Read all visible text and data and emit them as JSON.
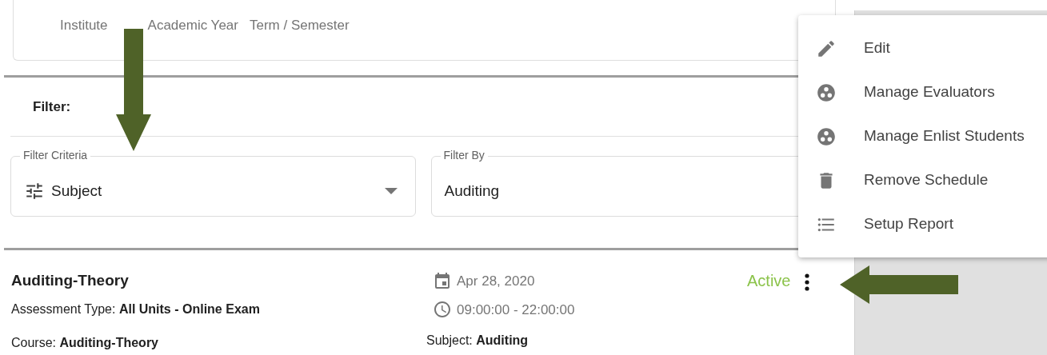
{
  "header_labels": [
    "Institute",
    "Academic Year",
    "Term / Semester"
  ],
  "filter": {
    "title": "Filter:",
    "fields": [
      {
        "kind": "select",
        "label": "Filter Criteria",
        "value": "Subject"
      },
      {
        "kind": "text",
        "label": "Filter By",
        "value": "Auditing"
      }
    ]
  },
  "schedule": {
    "title": "Auditing-Theory",
    "assessment": "Assessment Type: **All Units - Online Exam**",
    "course": "Course: **Auditing-Theory**",
    "date": "Apr 28, 2020",
    "time": "09:00:00 - 22:00:00",
    "subject": "Subject: **Auditing**",
    "status": "Active"
  },
  "menu": [
    {
      "kind": "edit",
      "label": "Edit"
    },
    {
      "kind": "group",
      "label": "Manage Evaluators"
    },
    {
      "kind": "group",
      "label": "Manage Enlist Students"
    },
    {
      "kind": "delete",
      "label": "Remove Schedule"
    },
    {
      "kind": "list",
      "label": "Setup Report"
    }
  ]
}
